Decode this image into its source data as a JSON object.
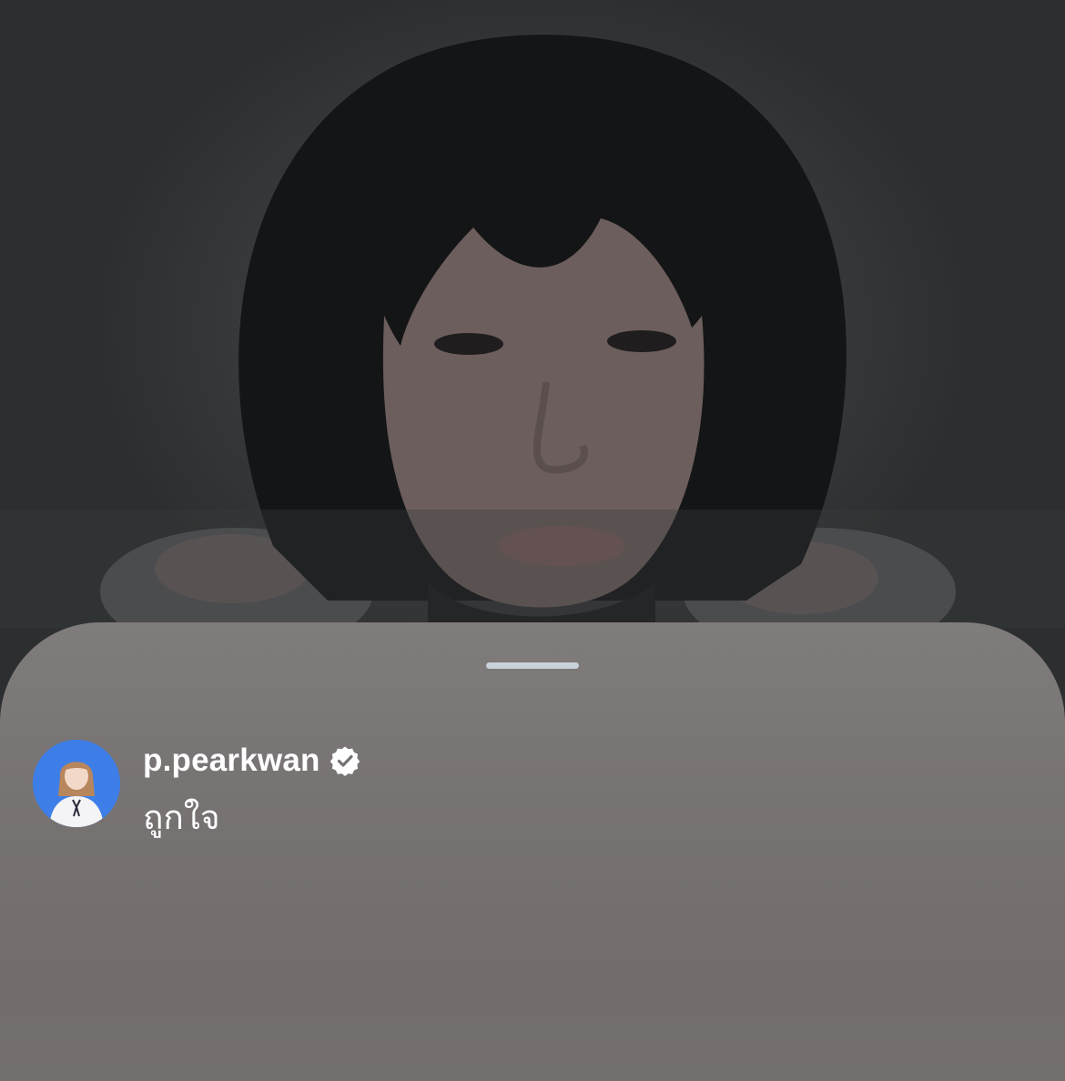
{
  "background": {
    "icon": "portrait-photo"
  },
  "sheet": {
    "grabber_icon": "drag-handle"
  },
  "comment": {
    "avatar_icon": "profile-avatar",
    "username": "p.pearkwan",
    "verified_icon": "verified-badge-icon",
    "text": "ถูกใจ"
  },
  "colors": {
    "avatar_bg": "#3d7ee8",
    "text": "#ffffff",
    "grabber": "#c9d1da"
  }
}
